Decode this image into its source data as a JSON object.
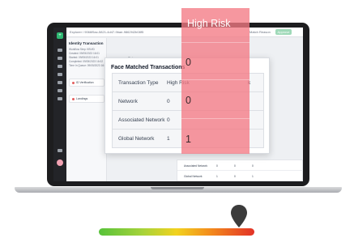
{
  "app": {
    "breadcrumb": "Explorer / 9066f5ac-5821-4d47-9bae-9862f42b08f5",
    "match_text": "Match Reason",
    "approve_label": "Approve",
    "sidebar_logo": "+"
  },
  "left_panel": {
    "title": "Identity Transaction",
    "lines": [
      "Workflow Step: KBVID",
      "Created: 09/05/2023 16:01",
      "Started: 09/05/2023 16:01",
      "Completed: 09/05/2023 16:02",
      "Time In Queue: 09/05/2023 16:02"
    ],
    "cards": [
      "ID Verification",
      "Landings"
    ]
  },
  "main": {
    "status_label": "Status",
    "status_value": "Select"
  },
  "modal": {
    "title": "Face Matched Transactions",
    "header": {
      "label": "Transaction Type",
      "col1": "High Risk",
      "col2": "k"
    },
    "rows": [
      {
        "label": "Network",
        "col1": "0",
        "col2": ""
      },
      {
        "label": "Associated Network",
        "col1": "0",
        "col2": ""
      },
      {
        "label": "Global Network",
        "col1": "1",
        "col2": ""
      }
    ]
  },
  "highlight": {
    "header": "High Risk",
    "values": [
      "0",
      "0",
      "1"
    ]
  },
  "background_table": {
    "rows": [
      {
        "label": "Associated Network",
        "vals": [
          "0",
          "0",
          "0"
        ]
      },
      {
        "label": "Global Network",
        "vals": [
          "1",
          "0",
          "1"
        ]
      }
    ]
  },
  "gauge": {
    "level_fraction": 0.9,
    "pin_color": "#3b3b3b",
    "colors": [
      "#57c23a",
      "#f2d21e",
      "#e23227"
    ]
  }
}
